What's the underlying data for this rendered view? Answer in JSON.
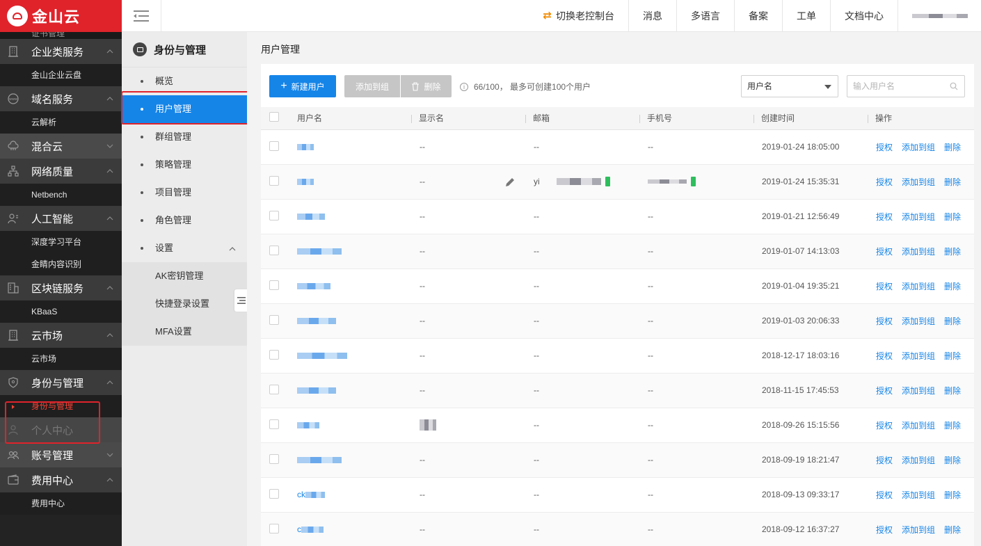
{
  "brand": {
    "name": "金山云",
    "color": "#e0232b"
  },
  "sidebar": {
    "cut_item": "证书管理",
    "groups": [
      {
        "label": "企业类服务",
        "icon": "building-icon",
        "expanded": true,
        "children": [
          "金山企业云盘"
        ]
      },
      {
        "label": "域名服务",
        "icon": "www-icon",
        "expanded": true,
        "children": [
          "云解析"
        ]
      },
      {
        "label": "混合云",
        "icon": "cloud-icon",
        "expanded": false,
        "children": []
      },
      {
        "label": "网络质量",
        "icon": "network-icon",
        "expanded": true,
        "children": [
          "Netbench"
        ]
      },
      {
        "label": "人工智能",
        "icon": "ai-icon",
        "expanded": true,
        "children": [
          "深度学习平台",
          "金睛内容识别"
        ]
      },
      {
        "label": "区块链服务",
        "icon": "blockchain-icon",
        "expanded": true,
        "children": [
          "KBaaS"
        ]
      },
      {
        "label": "云市场",
        "icon": "market-icon",
        "expanded": true,
        "children": [
          "云市场"
        ]
      },
      {
        "label": "身份与管理",
        "icon": "shield-icon",
        "expanded": true,
        "children": [
          "身份与管理"
        ]
      },
      {
        "label": "个人中心",
        "icon": "person-icon",
        "expanded": false,
        "children": []
      },
      {
        "label": "账号管理",
        "icon": "users-icon",
        "expanded": false,
        "children": []
      },
      {
        "label": "费用中心",
        "icon": "wallet-icon",
        "expanded": true,
        "children": [
          "费用中心"
        ]
      }
    ]
  },
  "topbar": {
    "switch_label": "切换老控制台",
    "items": [
      "消息",
      "多语言",
      "备案",
      "工单",
      "文档中心"
    ]
  },
  "subnav": {
    "title": "身份与管理",
    "items": [
      "概览",
      "用户管理",
      "群组管理",
      "策略管理",
      "项目管理",
      "角色管理",
      "设置"
    ],
    "active_index": 1,
    "settings_children": [
      "AK密钥管理",
      "快捷登录设置",
      "MFA设置"
    ]
  },
  "page": {
    "title": "用户管理",
    "new_user": "新建用户",
    "add_to_group": "添加到组",
    "delete": "删除",
    "info": "66/100， 最多可创建100个用户",
    "filter_selected": "用户名",
    "search_placeholder": "输入用户名"
  },
  "table": {
    "headers": [
      "用户名",
      "显示名",
      "邮箱",
      "手机号",
      "创建时间",
      "操作"
    ],
    "actions": [
      "授权",
      "添加到组",
      "删除"
    ],
    "rows": [
      {
        "username_text": "",
        "display": "--",
        "email_text": "--",
        "phone_text": "--",
        "created": "2019-01-24 18:05:00",
        "has_edit": false,
        "email_verified": false,
        "phone_verified": false,
        "blur": 24,
        "dblur": false
      },
      {
        "username_text": "",
        "display": "--",
        "email_text": "yi",
        "phone_text": "",
        "created": "2019-01-24 15:35:31",
        "has_edit": true,
        "email_verified": true,
        "phone_verified": true,
        "blur": 24,
        "dblur": false
      },
      {
        "username_text": "",
        "display": "--",
        "email_text": "--",
        "phone_text": "--",
        "created": "2019-01-21 12:56:49",
        "has_edit": false,
        "email_verified": false,
        "phone_verified": false,
        "blur": 40,
        "dblur": false
      },
      {
        "username_text": "",
        "display": "--",
        "email_text": "--",
        "phone_text": "--",
        "created": "2019-01-07 14:13:03",
        "has_edit": false,
        "email_verified": false,
        "phone_verified": false,
        "blur": 64,
        "dblur": false
      },
      {
        "username_text": "",
        "display": "--",
        "email_text": "--",
        "phone_text": "--",
        "created": "2019-01-04 19:35:21",
        "has_edit": false,
        "email_verified": false,
        "phone_verified": false,
        "blur": 48,
        "dblur": false
      },
      {
        "username_text": "",
        "display": "--",
        "email_text": "--",
        "phone_text": "--",
        "created": "2019-01-03 20:06:33",
        "has_edit": false,
        "email_verified": false,
        "phone_verified": false,
        "blur": 56,
        "dblur": false
      },
      {
        "username_text": "",
        "display": "--",
        "email_text": "--",
        "phone_text": "--",
        "created": "2018-12-17 18:03:16",
        "has_edit": false,
        "email_verified": false,
        "phone_verified": false,
        "blur": 72,
        "dblur": false
      },
      {
        "username_text": "",
        "display": "--",
        "email_text": "--",
        "phone_text": "--",
        "created": "2018-11-15 17:45:53",
        "has_edit": false,
        "email_verified": false,
        "phone_verified": false,
        "blur": 56,
        "dblur": false
      },
      {
        "username_text": "",
        "display": "",
        "email_text": "--",
        "phone_text": "--",
        "created": "2018-09-26 15:15:56",
        "has_edit": false,
        "email_verified": false,
        "phone_verified": false,
        "blur": 32,
        "dblur": true
      },
      {
        "username_text": "",
        "display": "--",
        "email_text": "--",
        "phone_text": "--",
        "created": "2018-09-19 18:21:47",
        "has_edit": false,
        "email_verified": false,
        "phone_verified": false,
        "blur": 64,
        "dblur": false
      },
      {
        "username_text": "ck",
        "display": "--",
        "email_text": "--",
        "phone_text": "--",
        "created": "2018-09-13 09:33:17",
        "has_edit": false,
        "email_verified": false,
        "phone_verified": false,
        "blur": 28,
        "dblur": false
      },
      {
        "username_text": "c",
        "display": "--",
        "email_text": "--",
        "phone_text": "--",
        "created": "2018-09-12 16:37:27",
        "has_edit": false,
        "email_verified": false,
        "phone_verified": false,
        "blur": 32,
        "dblur": false
      }
    ]
  }
}
